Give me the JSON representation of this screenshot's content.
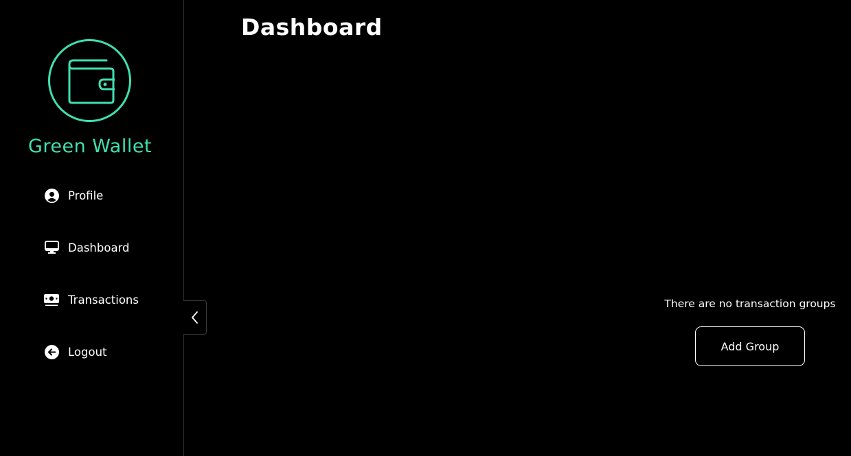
{
  "brand": {
    "name": "Green Wallet",
    "accent_color": "#3fe0b0",
    "logo_icon": "wallet-icon"
  },
  "sidebar": {
    "items": [
      {
        "label": "Profile",
        "icon": "user-circle-icon"
      },
      {
        "label": "Dashboard",
        "icon": "monitor-icon"
      },
      {
        "label": "Transactions",
        "icon": "money-icon"
      },
      {
        "label": "Logout",
        "icon": "arrow-left-circle-icon"
      }
    ],
    "collapse_icon": "chevron-left-icon"
  },
  "main": {
    "title": "Dashboard",
    "empty_message": "There are no transaction groups",
    "add_group_label": "Add Group"
  }
}
